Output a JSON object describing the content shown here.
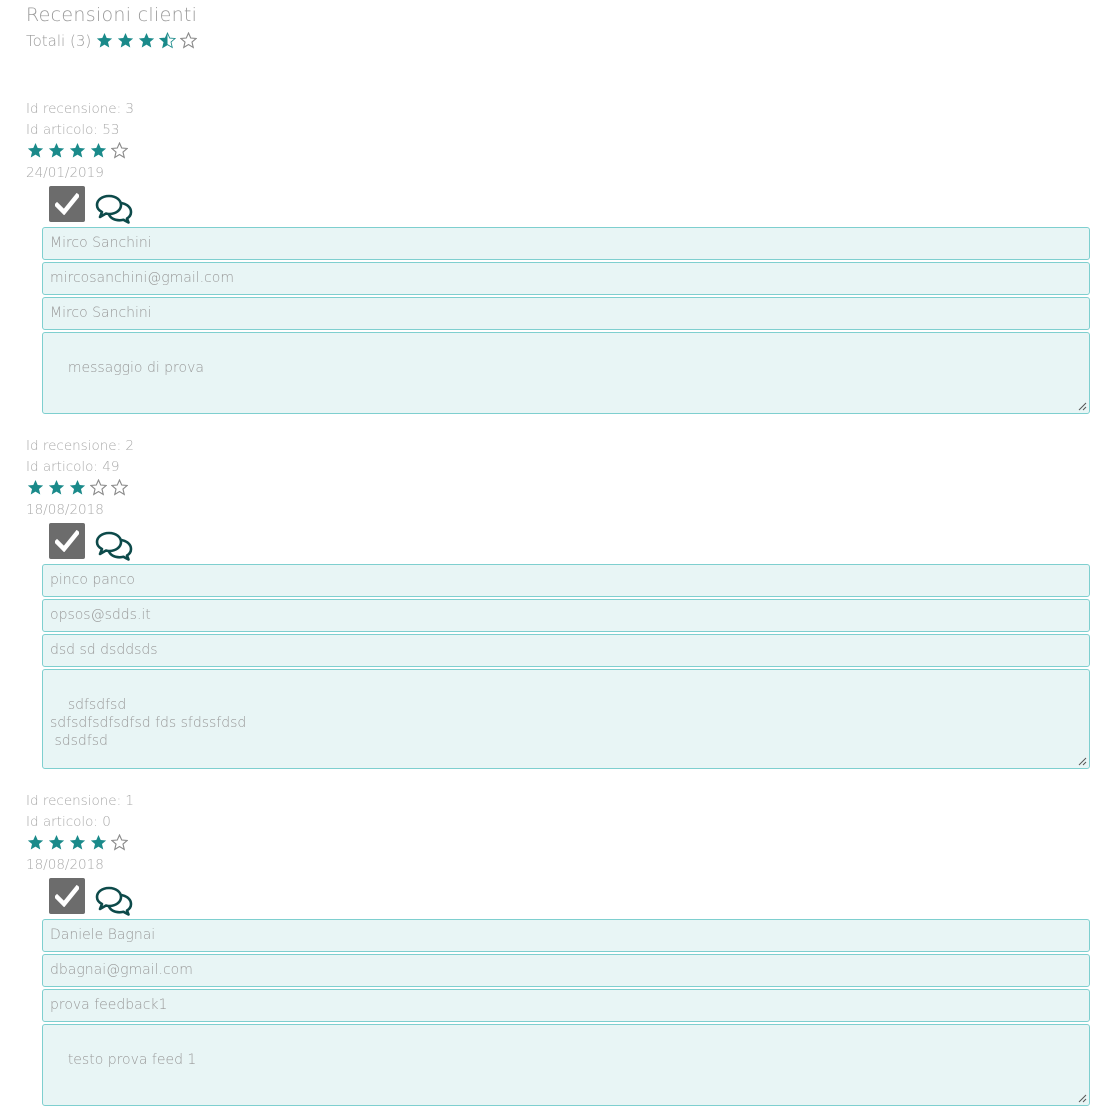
{
  "header": {
    "title": "Recensioni clienti",
    "totals_label": "Totali (3)",
    "average_rating": 3.5
  },
  "colors": {
    "accent": "#1a8a8a",
    "field_bg": "#e8f5f5",
    "field_border": "#7ecfcf",
    "button": "#6c6c6c",
    "icon": "#0d4a4a"
  },
  "icons": {
    "approve": "check-icon",
    "reply": "chat-bubbles-icon",
    "star": "star-icon"
  },
  "reviews": [
    {
      "review_id": "Id recensione: 3",
      "article_id": "Id articolo: 53",
      "rating": 4,
      "date": "24/01/2019",
      "name": "Mirco Sanchini",
      "email": "mircosanchini@gmail.com",
      "subject": "Mirco Sanchini",
      "message": "messaggio di prova"
    },
    {
      "review_id": "Id recensione: 2",
      "article_id": "Id articolo: 49",
      "rating": 3,
      "date": "18/08/2018",
      "name": "pinco panco",
      "email": "opsos@sdds.it",
      "subject": "dsd sd dsddsds",
      "message": "sdfsdfsd\nsdfsdfsdfsdfsd fds sfdssfdsd\n sdsdfsd"
    },
    {
      "review_id": "Id recensione: 1",
      "article_id": "Id articolo: 0",
      "rating": 4,
      "date": "18/08/2018",
      "name": "Daniele Bagnai",
      "email": "dbagnai@gmail.com",
      "subject": "prova feedback1",
      "message": "testo prova feed 1"
    }
  ]
}
